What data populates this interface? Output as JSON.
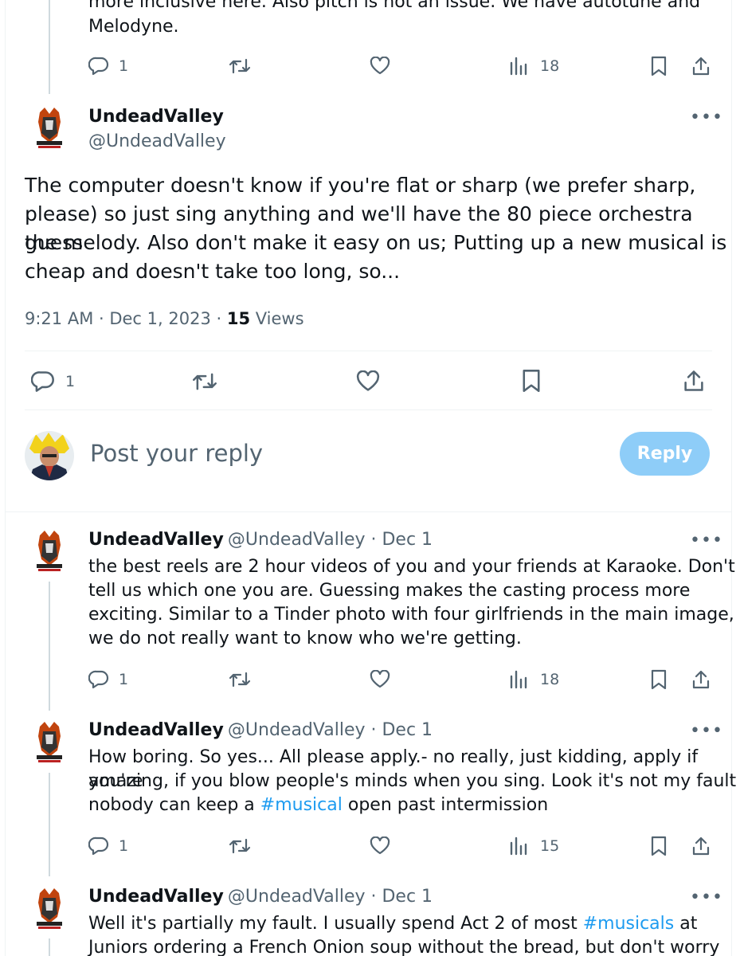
{
  "top_partial": {
    "line1": "more inclusive here. Also pitch is not an issue. We have autotune and",
    "line2": "Melodyne.",
    "actions": {
      "replies": "1",
      "views": "18"
    }
  },
  "main_post": {
    "name": "UndeadValley",
    "handle": "@UndeadValley",
    "more": "•••",
    "text_lines": [
      "The computer doesn't know if you're flat or sharp (we prefer sharp,",
      "please) so just sing anything and we'll have the 80 piece orchestra guess",
      "the melody. Also don't make it easy on us; Putting up a new musical is",
      "cheap and doesn't take too long, so..."
    ],
    "meta_time": "9:21 AM · Dec 1, 2023 · ",
    "meta_views_count": "15",
    "meta_views_label": " Views",
    "actions": {
      "replies": "1"
    }
  },
  "compose": {
    "placeholder": "Post your reply",
    "button": "Reply"
  },
  "replies": [
    {
      "name": "UndeadValley",
      "handle_date": "@UndeadValley · Dec 1",
      "more": "•••",
      "lines": [
        "the best reels are 2 hour videos of you and your friends at Karaoke. Don't",
        "tell us which one you are. Guessing makes the casting process more",
        "exciting. Similar to a Tinder photo with four girlfriends in the main image,",
        "we do not really want to know who we're getting."
      ],
      "actions": {
        "replies": "1",
        "views": "18"
      }
    },
    {
      "name": "UndeadValley",
      "handle_date": "@UndeadValley · Dec 1",
      "more": "•••",
      "line1": "How boring. So yes... All please apply.- no really, just kidding, apply if you're",
      "line2": "amazing, if you blow people's minds when you sing.  Look it's not my fault",
      "line3_pre": "nobody can keep a ",
      "line3_tag": "#musical",
      "line3_post": " open past intermission",
      "actions": {
        "replies": "1",
        "views": "15"
      }
    },
    {
      "name": "UndeadValley",
      "handle_date": "@UndeadValley · Dec 1",
      "more": "•••",
      "line1_pre": "Well it's partially my fault. I usually spend Act 2 of most ",
      "line1_tag": "#musicals",
      "line1_post": " at",
      "line2": "Juniors ordering a French Onion soup without the bread, but don't worry"
    }
  ],
  "icons": {
    "reply": "reply-icon",
    "repost": "repost-icon",
    "like": "like-icon",
    "views": "views-icon",
    "bookmark": "bookmark-icon",
    "share": "share-icon"
  },
  "colors": {
    "accent": "#1d9bf0",
    "reply_button": "#8ecdf8",
    "secondary_text": "#536471"
  }
}
